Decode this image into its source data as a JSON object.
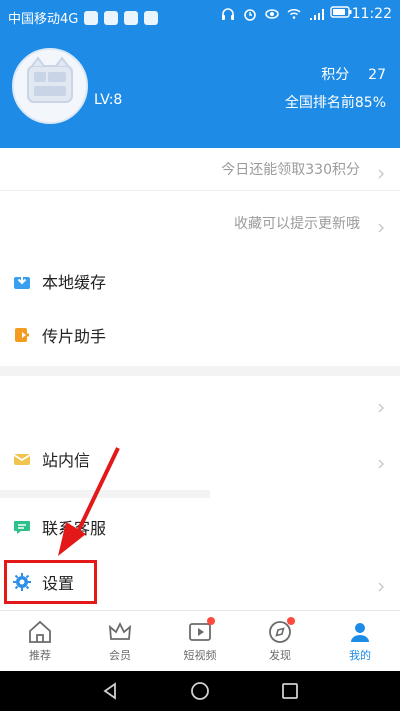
{
  "status_bar": {
    "carrier": "中国移动4G",
    "time": "11:22",
    "icons": [
      "sim-icon",
      "app-icon",
      "app-icon",
      "app-icon",
      "headphones-icon",
      "alarm-icon",
      "eye-icon",
      "wifi-icon",
      "signal-icon",
      "battery-icon"
    ]
  },
  "profile": {
    "level": "LV:8",
    "points_label": "积分",
    "points_value": "27",
    "rank": "全国排名前85%"
  },
  "rows": {
    "claim_points": "今日还能领取330积分",
    "favorite_hint": "收藏可以提示更新哦",
    "local_cache": "本地缓存",
    "upload_helper": "传片助手",
    "messages": "站内信",
    "contact_support": "联系客服",
    "settings": "设置"
  },
  "bottom_nav": {
    "items": [
      {
        "label": "推荐",
        "icon": "home-icon",
        "active": false
      },
      {
        "label": "会员",
        "icon": "crown-icon",
        "active": false
      },
      {
        "label": "短视频",
        "icon": "video-icon",
        "active": false
      },
      {
        "label": "发现",
        "icon": "compass-icon",
        "active": false
      },
      {
        "label": "我的",
        "icon": "user-icon",
        "active": true
      }
    ]
  },
  "colors": {
    "brand": "#1e8be6",
    "highlight": "#e31818"
  }
}
